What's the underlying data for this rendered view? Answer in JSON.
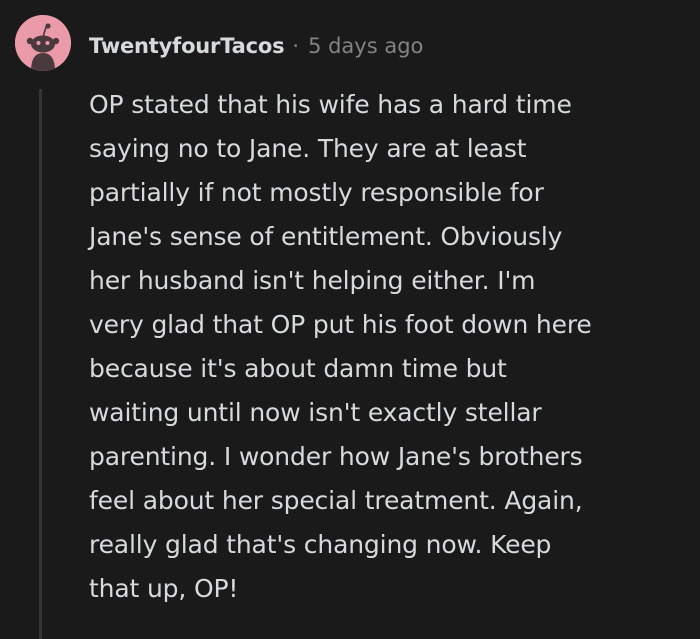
{
  "comment": {
    "avatar_icon": "reddit-snoo-avatar-icon",
    "avatar_color": "#ea9aa8",
    "author": "TwentyfourTacos",
    "separator": "·",
    "time": "5 days ago",
    "body_lines": [
      "OP stated that his wife has a hard time",
      "saying no to Jane. They are at least",
      "partially if not mostly responsible for",
      "Jane's sense of entitlement. Obviously",
      "her husband isn't helping either. I'm",
      "very glad that OP put his foot down here",
      "because it's about damn time but",
      "waiting until now isn't exactly stellar",
      "parenting. I wonder how Jane's brothers",
      "feel about her special treatment. Again,",
      "really glad that's changing now. Keep",
      "that up, OP!"
    ]
  }
}
